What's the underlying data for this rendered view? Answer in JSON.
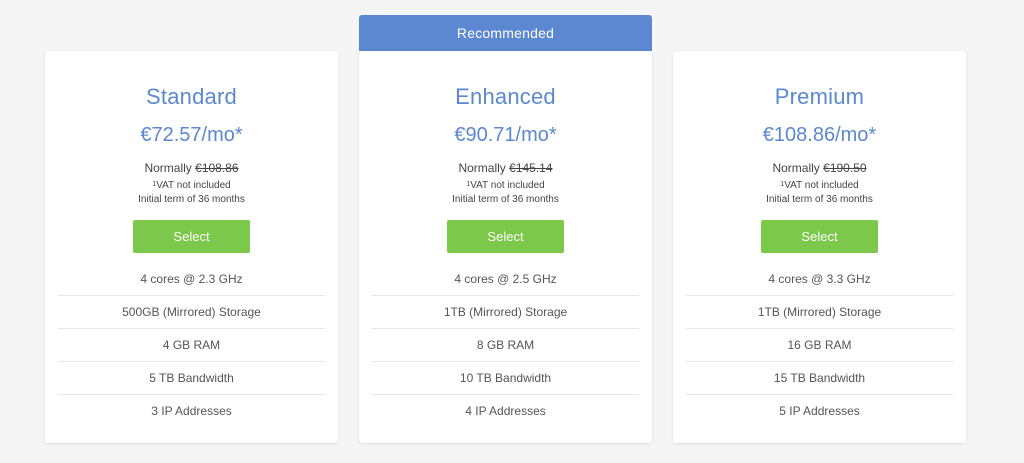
{
  "ribbon": {
    "label": "Recommended"
  },
  "plans": [
    {
      "name": "Standard",
      "price": "€72.57/mo*",
      "normally_label": "Normally",
      "normally_price": "€108.86",
      "vat_sup": "1",
      "vat_text": "VAT not included",
      "term": "Initial term of 36 months",
      "button": "Select",
      "features": [
        "4 cores @ 2.3 GHz",
        "500GB (Mirrored) Storage",
        "4 GB RAM",
        "5 TB Bandwidth",
        "3 IP Addresses"
      ]
    },
    {
      "name": "Enhanced",
      "price": "€90.71/mo*",
      "normally_label": "Normally",
      "normally_price": "€145.14",
      "vat_sup": "1",
      "vat_text": "VAT not included",
      "term": "Initial term of 36 months",
      "button": "Select",
      "features": [
        "4 cores @ 2.5 GHz",
        "1TB (Mirrored) Storage",
        "8 GB RAM",
        "10 TB Bandwidth",
        "4 IP Addresses"
      ]
    },
    {
      "name": "Premium",
      "price": "€108.86/mo*",
      "normally_label": "Normally",
      "normally_price": "€190.50",
      "vat_sup": "1",
      "vat_text": "VAT not included",
      "term": "Initial term of 36 months",
      "button": "Select",
      "features": [
        "4 cores @ 3.3 GHz",
        "1TB (Mirrored) Storage",
        "16 GB RAM",
        "15 TB Bandwidth",
        "5 IP Addresses"
      ]
    }
  ],
  "colors": {
    "accent": "#5b88d0",
    "button": "#7cc84a",
    "background": "#f5f5f5"
  }
}
